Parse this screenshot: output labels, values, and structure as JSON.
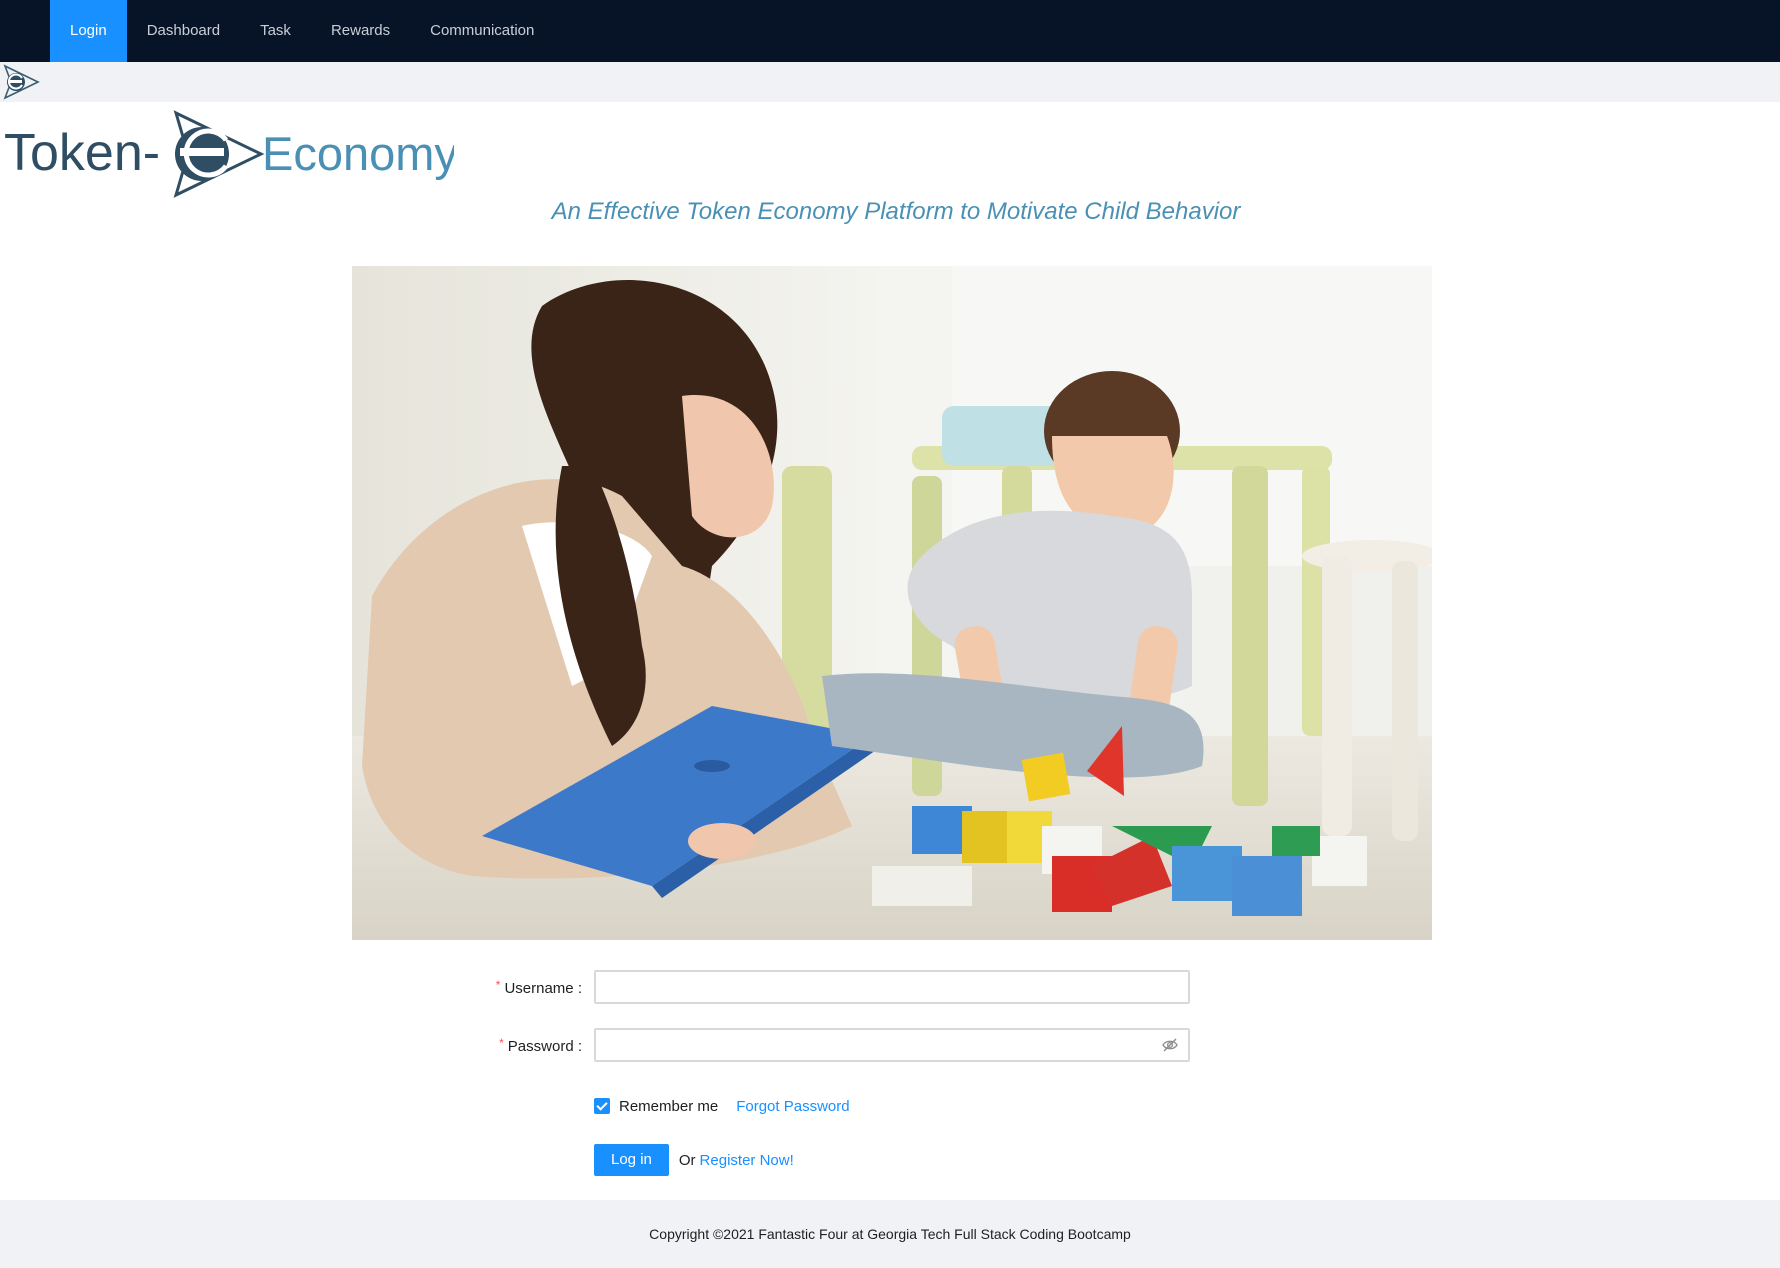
{
  "nav": {
    "items": [
      {
        "label": "Login"
      },
      {
        "label": "Dashboard"
      },
      {
        "label": "Task"
      },
      {
        "label": "Rewards"
      },
      {
        "label": "Communication"
      }
    ],
    "active": "Login"
  },
  "brand": {
    "prefix": "Token-",
    "letter": "e",
    "suffix": "Economy"
  },
  "tagline": "An Effective Token Economy Platform to Motivate Child Behavior",
  "form": {
    "username_label": "Username",
    "password_label": "Password",
    "username_value": "",
    "password_value": "",
    "remember_label": "Remember me",
    "remember_checked": true,
    "forgot_label": "Forgot Password",
    "login_button": "Log in",
    "or_text": "Or",
    "register_label": "Register Now!"
  },
  "footer": {
    "text": "Copyright ©2021 Fantastic Four at Georgia Tech Full Stack Coding Bootcamp"
  },
  "colors": {
    "nav_bg": "#071427",
    "accent": "#1890ff",
    "brand_dark": "#2f4e63",
    "brand_light": "#4a90b4",
    "required": "#ff4d4f"
  },
  "icons": [
    "app-logo-icon",
    "eye-invisible-icon",
    "check-icon"
  ]
}
